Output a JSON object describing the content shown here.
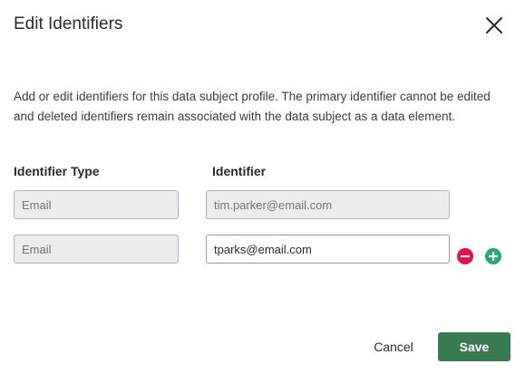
{
  "dialog": {
    "title": "Edit Identifiers",
    "description": "Add or edit identifiers for this data subject profile. The primary identifier cannot be edited and deleted identifiers remain associated with the data subject as a data element."
  },
  "columns": {
    "type_header": "Identifier Type",
    "identifier_header": "Identifier"
  },
  "rows": [
    {
      "type_placeholder": "Email",
      "identifier_value": "tim.parker@email.com",
      "editable": false
    },
    {
      "type_placeholder": "Email",
      "identifier_value": "tparks@email.com",
      "editable": true
    }
  ],
  "actions": {
    "cancel_label": "Cancel",
    "save_label": "Save"
  },
  "colors": {
    "save_button": "#3a7a52",
    "remove_icon": "#e0134a",
    "add_icon": "#2aa57a",
    "disabled_field": "#ececec"
  },
  "icons": {
    "close": "close-icon",
    "remove": "minus-circle-icon",
    "add": "plus-circle-icon"
  }
}
